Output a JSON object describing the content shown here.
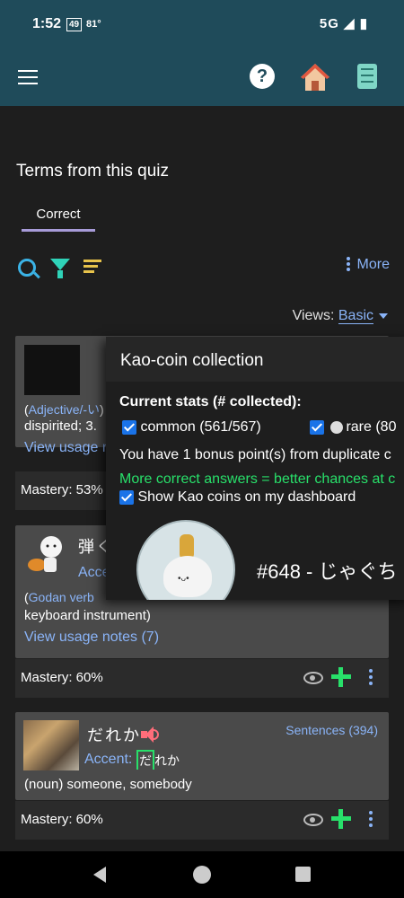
{
  "status_bar": {
    "time": "1:52",
    "badge": "49",
    "temp": "81°",
    "network": "5G"
  },
  "appbar": {
    "help": "?"
  },
  "section_title": "Terms from this quiz",
  "tabs": [
    {
      "label": "Correct"
    }
  ],
  "toolbar": {
    "more_label": "More"
  },
  "views": {
    "label": "Views:",
    "value": "Basic"
  },
  "cards": [
    {
      "pos": "Adjective/-い",
      "def": "dispirited; 3.",
      "usage": "View usage n",
      "mastery": "Mastery: 53%"
    },
    {
      "word": "弾く",
      "accent_label": "Accent",
      "pos": "Godan verb",
      "def": "keyboard instrument)",
      "usage": "View usage notes (7)",
      "mastery": "Mastery: 60%"
    },
    {
      "word": "だれか",
      "sentences": "Sentences (394)",
      "accent_label": "Accent:",
      "accent_first": "だ",
      "accent_rest": "れか",
      "pos": "(noun)",
      "def": "someone, somebody",
      "mastery": "Mastery: 60%"
    }
  ],
  "popup": {
    "title": "Kao-coin collection",
    "stats_heading": "Current stats (# collected):",
    "common": "common (561/567)",
    "rare": "rare (80",
    "bonus": "You have 1 bonus point(s) from duplicate c",
    "tip": "More correct answers = better chances at c",
    "dashboard": "Show Kao coins on my dashboard",
    "coin_number": "#648 - じゃぐち",
    "coin_face": "•ᴗ•"
  }
}
